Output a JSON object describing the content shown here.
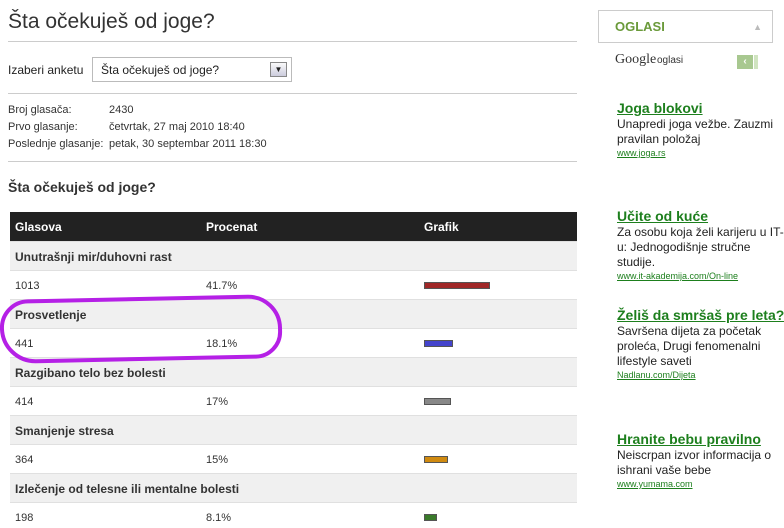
{
  "poll": {
    "title": "Šta očekuješ od joge?",
    "select_label": "Izaberi anketu",
    "selected_poll": "Šta očekuješ od joge?",
    "stats": [
      {
        "label": "Broj glasača:",
        "value": "2430"
      },
      {
        "label": "Prvo glasanje:",
        "value": "četvrtak, 27 maj 2010 18:40"
      },
      {
        "label": "Poslednje glasanje:",
        "value": "petak, 30 septembar 2011 18:30"
      }
    ],
    "question": "Šta očekuješ od joge?",
    "columns": [
      "Glasova",
      "Procenat",
      "Grafik"
    ],
    "options": [
      {
        "name": "Unutrašnji mir/duhovni rast",
        "votes": "1013",
        "percent": "41.7%",
        "share": 41.7,
        "color": "#a02828"
      },
      {
        "name": "Prosvetlenje",
        "votes": "441",
        "percent": "18.1%",
        "share": 18.1,
        "color": "#4444cc"
      },
      {
        "name": "Razgibano telo bez bolesti",
        "votes": "414",
        "percent": "17%",
        "share": 17,
        "color": "#888888"
      },
      {
        "name": "Smanjenje stresa",
        "votes": "364",
        "percent": "15%",
        "share": 15,
        "color": "#d08a10"
      },
      {
        "name": "Izlečenje od telesne ili mentalne bolesti",
        "votes": "198",
        "percent": "8.1%",
        "share": 8.1,
        "color": "#3a7a2a"
      }
    ]
  },
  "sidebar": {
    "header": "OGLASI",
    "google_logo": "Google",
    "google_label": "oglasi",
    "ads": [
      {
        "title": "Joga blokovi",
        "text": "Unapredi joga vežbe. Zauzmi pravilan položaj",
        "url": "www.joga.rs"
      },
      {
        "title": "Učite od kuće",
        "text": "Za osobu koja želi karijeru u IT-u: Jednogodišnje stručne studije.",
        "url": "www.it-akademija.com/On-line"
      },
      {
        "title": "Želiš da smršaš pre leta?",
        "text": "Savršena dijeta za početak proleća, Drugi fenomenalni lifestyle saveti",
        "url": "Nadlanu.com/Dijeta"
      },
      {
        "title": "Hranite bebu pravilno",
        "text": "Neiscrpan izvor informacija o ishrani vaše bebe",
        "url": "www.yumama.com"
      }
    ]
  },
  "colors": {
    "highlight": "#b520e6",
    "ad_green": "#1d7f1d",
    "header_green": "#6a9a3a"
  }
}
